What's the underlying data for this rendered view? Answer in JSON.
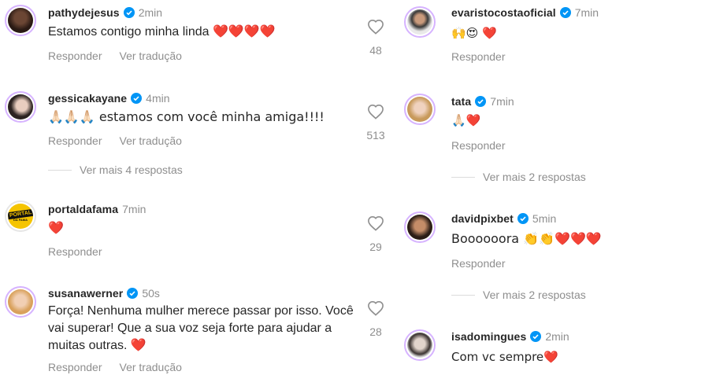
{
  "accent": "#0095f6",
  "heart_color": "#e0162b",
  "left": {
    "comments": [
      {
        "username": "pathydejesus",
        "verified": true,
        "time": "2min",
        "text": "Estamos contigo minha linda ❤️❤️❤️❤️",
        "reply": "Responder",
        "translate": "Ver tradução",
        "likes": "48"
      },
      {
        "username": "gessicakayane",
        "verified": true,
        "time": "4min",
        "text": "🙏🏻🙏🏻🙏🏻 estamos com você minha amiga!!!!",
        "reply": "Responder",
        "translate": "Ver tradução",
        "likes": "513",
        "more": "Ver mais 4 respostas"
      },
      {
        "username": "portaldafama",
        "verified": false,
        "time": "7min",
        "text": "❤️",
        "reply": "Responder",
        "likes": "29",
        "avatar_text": "PORTAL",
        "avatar_subtext": "DA FAMA"
      },
      {
        "username": "susanawerner",
        "verified": true,
        "time": "50s",
        "text": "Força! Nenhuma mulher merece passar por isso. Você vai superar! Que a sua voz seja forte para ajudar a muitas outras. ❤️",
        "reply": "Responder",
        "translate": "Ver tradução",
        "likes": "28"
      }
    ]
  },
  "right": {
    "comments": [
      {
        "username": "evaristocostaoficial",
        "verified": true,
        "time": "7min",
        "text": "🙌😍 ❤️",
        "reply": "Responder"
      },
      {
        "username": "tata",
        "verified": true,
        "time": "7min",
        "text": "🙏🏻❤️",
        "reply": "Responder",
        "more": "Ver mais 2 respostas"
      },
      {
        "username": "davidpixbet",
        "verified": true,
        "time": "5min",
        "text": "Boooooora 👏👏❤️❤️❤️",
        "reply": "Responder",
        "more": "Ver mais 2 respostas"
      },
      {
        "username": "isadomingues",
        "verified": true,
        "time": "2min",
        "text": "Com vc sempre❤️"
      }
    ]
  }
}
